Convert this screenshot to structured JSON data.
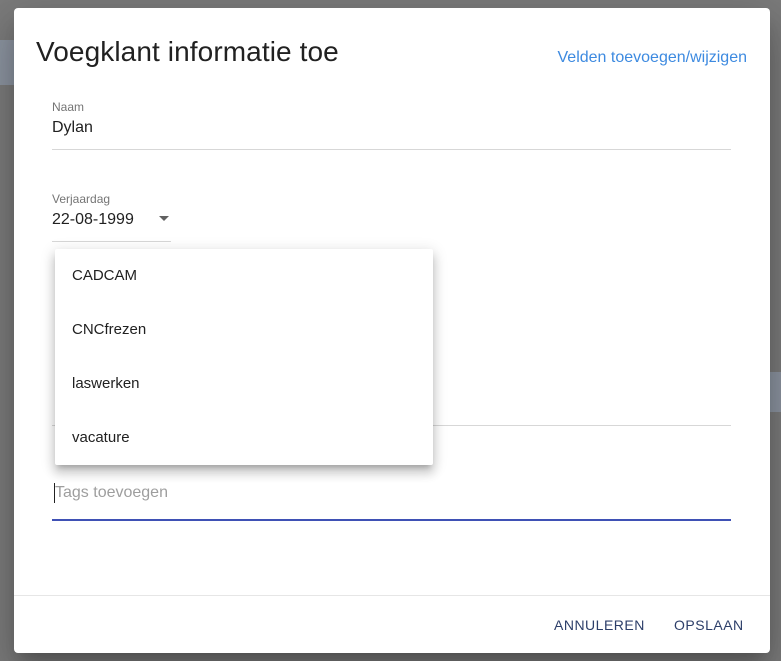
{
  "dialog": {
    "title": "Voegklant informatie toe",
    "edit_fields_link": "Velden toevoegen/wijzigen"
  },
  "fields": {
    "name": {
      "label": "Naam",
      "value": "Dylan"
    },
    "birthday": {
      "label": "Verjaardag",
      "value": "22-08-1999"
    },
    "tags": {
      "placeholder": "Tags toevoegen",
      "value": ""
    }
  },
  "tag_suggestions": [
    "CADCAM",
    "CNCfrezen",
    "laswerken",
    "vacature"
  ],
  "actions": {
    "cancel_label": "ANNULEREN",
    "save_label": "OPSLAAN"
  },
  "colors": {
    "link": "#3d8ae0",
    "focus_underline": "#3f51b5",
    "button_text": "#2c3e69"
  }
}
